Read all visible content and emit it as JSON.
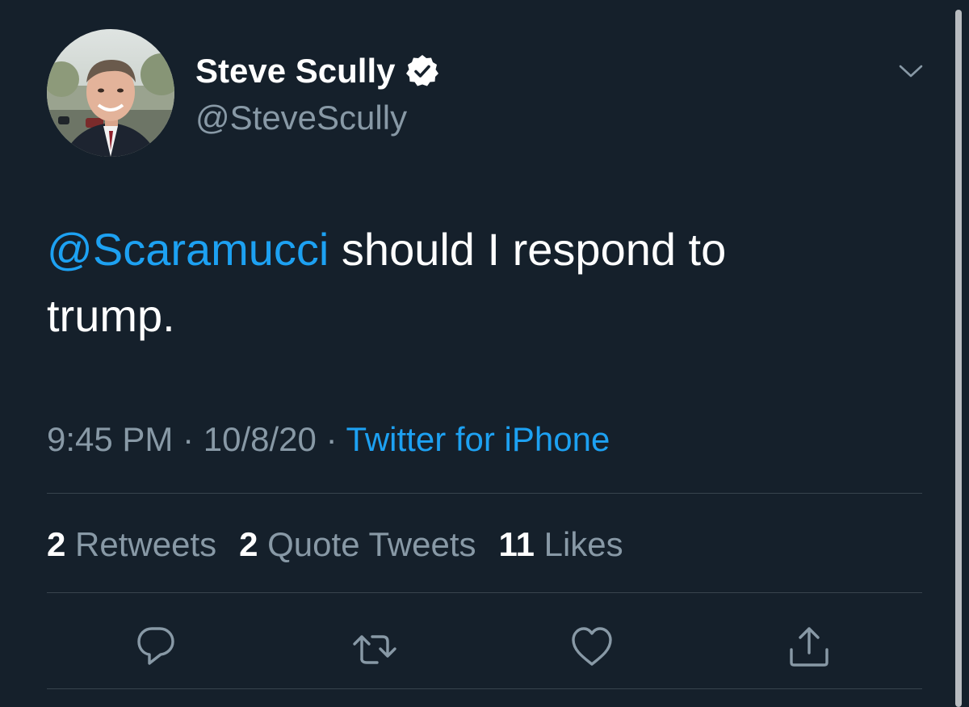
{
  "tweet": {
    "author": {
      "name": "Steve Scully",
      "handle": "@SteveScully",
      "verified": true
    },
    "mention": "@Scaramucci",
    "text": " should I respond to trump.",
    "time": "9:45 PM",
    "date": "10/8/20",
    "separator": "·",
    "source": "Twitter for iPhone"
  },
  "stats": {
    "retweets_count": "2",
    "retweets_label": "Retweets",
    "quotes_count": "2",
    "quotes_label": "Quote Tweets",
    "likes_count": "11",
    "likes_label": "Likes"
  },
  "icons": {
    "more": "chevron-down-icon",
    "reply": "reply-icon",
    "retweet": "retweet-icon",
    "like": "heart-icon",
    "share": "share-icon"
  },
  "colors": {
    "background": "#15202b",
    "accent": "#1da1f2",
    "secondary_text": "#8899a6",
    "divider": "#38444d"
  }
}
